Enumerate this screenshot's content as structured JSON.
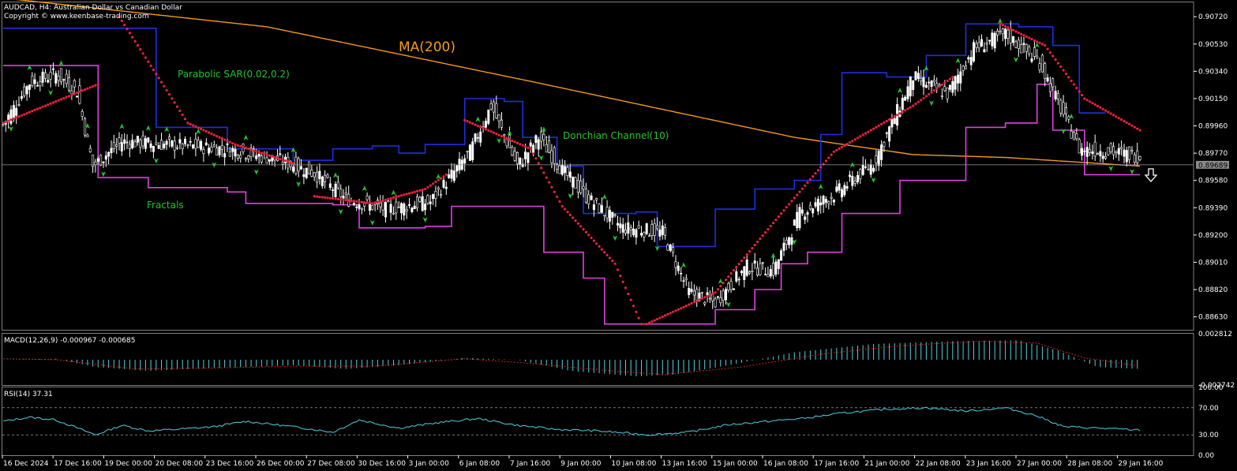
{
  "header": {
    "title": "AUDCAD, H4:  Australian Dollar vs Canadian Dollar",
    "copyright": "Copyright © www.keenbase-trading.com"
  },
  "colors": {
    "background": "#000000",
    "candle": "#ffffff",
    "ma200": "#f59a1c",
    "donchian_upper": "#1f2fdc",
    "donchian_lower": "#e040e0",
    "sar": "#e8223a",
    "fractal": "#22c52a",
    "annotation": "#22c52a",
    "macd_hist": "#4fd0e0",
    "macd_signal": "#d02020",
    "rsi": "#4fd0e0",
    "axis_text": "#ffffff",
    "frame": "#808080"
  },
  "chart_data": {
    "type": "line",
    "title": "AUDCAD, H4:  Australian Dollar vs Canadian Dollar",
    "price_panel": {
      "ylim": [
        0.8854,
        0.9082
      ],
      "y_ticks": [
        "0.90720",
        "0.90530",
        "0.90340",
        "0.90150",
        "0.89960",
        "0.89770",
        "0.89580",
        "0.89390",
        "0.89200",
        "0.89010",
        "0.88820",
        "0.88630"
      ],
      "current_price": "0.89689",
      "annotations": {
        "ma": "MA(200)",
        "sar": "Parabolic SAR(0.02,0.2)",
        "donchian": "Donchian Channel(10)",
        "fractals": "Fractals"
      },
      "close_keypoints": [
        [
          0,
          0.8997
        ],
        [
          10,
          0.9026
        ],
        [
          20,
          0.9032
        ],
        [
          28,
          0.902
        ],
        [
          34,
          0.8968
        ],
        [
          45,
          0.8985
        ],
        [
          70,
          0.8982
        ],
        [
          85,
          0.898
        ],
        [
          105,
          0.8972
        ],
        [
          118,
          0.8963
        ],
        [
          130,
          0.8945
        ],
        [
          145,
          0.8938
        ],
        [
          162,
          0.8943
        ],
        [
          177,
          0.8978
        ],
        [
          185,
          0.901
        ],
        [
          195,
          0.8968
        ],
        [
          203,
          0.8988
        ],
        [
          212,
          0.8965
        ],
        [
          222,
          0.8945
        ],
        [
          235,
          0.8925
        ],
        [
          250,
          0.8922
        ],
        [
          260,
          0.888
        ],
        [
          270,
          0.8873
        ],
        [
          282,
          0.8898
        ],
        [
          292,
          0.8895
        ],
        [
          302,
          0.8935
        ],
        [
          315,
          0.8948
        ],
        [
          330,
          0.897
        ],
        [
          345,
          0.903
        ],
        [
          358,
          0.9018
        ],
        [
          368,
          0.905
        ],
        [
          380,
          0.906
        ],
        [
          393,
          0.904
        ],
        [
          408,
          0.898
        ],
        [
          420,
          0.8978
        ],
        [
          431,
          0.8975
        ]
      ],
      "ma200": [
        [
          0,
          0.9085
        ],
        [
          100,
          0.9065
        ],
        [
          200,
          0.9027
        ],
        [
          300,
          0.8988
        ],
        [
          345,
          0.8976
        ],
        [
          380,
          0.8974
        ],
        [
          431,
          0.8968
        ]
      ],
      "donchian_upper": [
        [
          0,
          0.9064
        ],
        [
          45,
          0.9064
        ],
        [
          58,
          0.8995
        ],
        [
          85,
          0.898
        ],
        [
          110,
          0.8972
        ],
        [
          125,
          0.898
        ],
        [
          140,
          0.8982
        ],
        [
          150,
          0.8977
        ],
        [
          160,
          0.8983
        ],
        [
          175,
          0.9015
        ],
        [
          190,
          0.9013
        ],
        [
          197,
          0.8988
        ],
        [
          210,
          0.8968
        ],
        [
          220,
          0.8935
        ],
        [
          240,
          0.8936
        ],
        [
          248,
          0.8912
        ],
        [
          265,
          0.8912
        ],
        [
          270,
          0.8938
        ],
        [
          285,
          0.8952
        ],
        [
          300,
          0.8958
        ],
        [
          310,
          0.899
        ],
        [
          318,
          0.9033
        ],
        [
          335,
          0.903
        ],
        [
          350,
          0.9045
        ],
        [
          365,
          0.9067
        ],
        [
          385,
          0.9065
        ],
        [
          398,
          0.9052
        ],
        [
          408,
          0.9005
        ],
        [
          418,
          0.9005
        ]
      ],
      "donchian_lower": [
        [
          0,
          0.9038
        ],
        [
          30,
          0.9038
        ],
        [
          36,
          0.896
        ],
        [
          55,
          0.8953
        ],
        [
          85,
          0.895
        ],
        [
          92,
          0.8942
        ],
        [
          125,
          0.8941
        ],
        [
          135,
          0.8925
        ],
        [
          160,
          0.8926
        ],
        [
          170,
          0.894
        ],
        [
          195,
          0.894
        ],
        [
          205,
          0.8908
        ],
        [
          220,
          0.889
        ],
        [
          228,
          0.8858
        ],
        [
          262,
          0.8858
        ],
        [
          270,
          0.8868
        ],
        [
          285,
          0.8882
        ],
        [
          295,
          0.89
        ],
        [
          305,
          0.8908
        ],
        [
          318,
          0.8935
        ],
        [
          340,
          0.8958
        ],
        [
          358,
          0.8958
        ],
        [
          365,
          0.8995
        ],
        [
          380,
          0.8998
        ],
        [
          392,
          0.9025
        ],
        [
          398,
          0.8993
        ],
        [
          410,
          0.8962
        ],
        [
          431,
          0.8962
        ]
      ],
      "sar_segments": [
        {
          "points": [
            [
              0,
              0.8998
            ],
            [
              36,
              0.9025
            ]
          ]
        },
        {
          "points": [
            [
              44,
              0.9072
            ],
            [
              70,
              0.8998
            ],
            [
              88,
              0.8983
            ],
            [
              110,
              0.897
            ]
          ]
        },
        {
          "points": [
            [
              118,
              0.8947
            ],
            [
              140,
              0.8942
            ],
            [
              160,
              0.8952
            ],
            [
              168,
              0.8962
            ]
          ]
        },
        {
          "points": [
            [
              175,
              0.9
            ],
            [
              200,
              0.898
            ],
            [
              212,
              0.894
            ],
            [
              232,
              0.89
            ],
            [
              242,
              0.8858
            ]
          ]
        },
        {
          "points": [
            [
              244,
              0.8858
            ],
            [
              270,
              0.888
            ],
            [
              295,
              0.8935
            ],
            [
              315,
              0.8978
            ],
            [
              345,
              0.901
            ],
            [
              360,
              0.903
            ]
          ]
        },
        {
          "points": [
            [
              378,
              0.9067
            ],
            [
              395,
              0.9052
            ],
            [
              410,
              0.9015
            ],
            [
              431,
              0.8993
            ]
          ]
        }
      ],
      "fractals_up_index": [
        10,
        22,
        32,
        45,
        55,
        62,
        74,
        92,
        110,
        126,
        137,
        148,
        165,
        180,
        192,
        205,
        228,
        258,
        272,
        292,
        310,
        322,
        340,
        350,
        362,
        378,
        392,
        405
      ],
      "fractals_down_index": [
        3,
        18,
        38,
        58,
        80,
        96,
        112,
        128,
        140,
        160,
        188,
        204,
        215,
        232,
        248,
        275,
        300,
        330,
        352,
        384,
        402,
        420,
        428
      ]
    },
    "macd_panel": {
      "label": "MACD(12,26,9) -0.000967 -0.000685",
      "ylim": [
        -0.002742,
        0.002812
      ],
      "y_ticks": [
        "0.002812",
        "-0.002742"
      ],
      "histogram_keypoints": [
        [
          0,
          0.0
        ],
        [
          20,
          0.0001
        ],
        [
          35,
          -0.0008
        ],
        [
          55,
          -0.0012
        ],
        [
          80,
          -0.0009
        ],
        [
          110,
          -0.0006
        ],
        [
          130,
          -0.001
        ],
        [
          150,
          -0.0006
        ],
        [
          175,
          0.0002
        ],
        [
          195,
          0.0
        ],
        [
          215,
          -0.0012
        ],
        [
          240,
          -0.0018
        ],
        [
          255,
          -0.0016
        ],
        [
          275,
          -0.0006
        ],
        [
          300,
          0.0008
        ],
        [
          330,
          0.0017
        ],
        [
          360,
          0.002
        ],
        [
          385,
          0.0021
        ],
        [
          400,
          0.001
        ],
        [
          415,
          -0.0008
        ],
        [
          431,
          -0.001
        ]
      ],
      "signal_keypoints": [
        [
          0,
          0.0001
        ],
        [
          20,
          0.0
        ],
        [
          50,
          -0.001
        ],
        [
          80,
          -0.0009
        ],
        [
          110,
          -0.0007
        ],
        [
          140,
          -0.0007
        ],
        [
          175,
          0.0001
        ],
        [
          200,
          -0.0004
        ],
        [
          230,
          -0.0012
        ],
        [
          250,
          -0.0016
        ],
        [
          280,
          -0.0008
        ],
        [
          310,
          0.0006
        ],
        [
          340,
          0.0015
        ],
        [
          370,
          0.002
        ],
        [
          392,
          0.0018
        ],
        [
          410,
          0.0002
        ],
        [
          431,
          -0.0007
        ]
      ]
    },
    "rsi_panel": {
      "label": "RSI(14) 37.31",
      "ylim": [
        0,
        100
      ],
      "y_ticks": [
        "100.00",
        "70.00",
        "30.00",
        "0.00"
      ],
      "levels": [
        70,
        30
      ],
      "keypoints": [
        [
          0,
          50
        ],
        [
          10,
          56
        ],
        [
          20,
          52
        ],
        [
          35,
          30
        ],
        [
          45,
          44
        ],
        [
          55,
          36
        ],
        [
          65,
          38
        ],
        [
          80,
          42
        ],
        [
          92,
          50
        ],
        [
          110,
          42
        ],
        [
          125,
          34
        ],
        [
          135,
          52
        ],
        [
          150,
          40
        ],
        [
          165,
          48
        ],
        [
          180,
          54
        ],
        [
          195,
          44
        ],
        [
          210,
          38
        ],
        [
          225,
          36
        ],
        [
          245,
          30
        ],
        [
          260,
          34
        ],
        [
          275,
          45
        ],
        [
          290,
          50
        ],
        [
          305,
          55
        ],
        [
          318,
          62
        ],
        [
          335,
          68
        ],
        [
          350,
          70
        ],
        [
          365,
          65
        ],
        [
          380,
          70
        ],
        [
          392,
          58
        ],
        [
          402,
          42
        ],
        [
          415,
          40
        ],
        [
          431,
          37
        ]
      ]
    },
    "x_ticks": [
      "16 Dec 2024",
      "17 Dec 16:00",
      "19 Dec 00:00",
      "20 Dec 08:00",
      "23 Dec 16:00",
      "26 Dec 00:00",
      "27 Dec 08:00",
      "30 Dec 16:00",
      "3 Jan 00:00",
      "6 Jan 08:00",
      "7 Jan 16:00",
      "9 Jan 00:00",
      "10 Jan 08:00",
      "13 Jan 16:00",
      "15 Jan 00:00",
      "16 Jan 08:00",
      "17 Jan 16:00",
      "21 Jan 00:00",
      "22 Jan 08:00",
      "23 Jan 16:00",
      "27 Jan 00:00",
      "28 Jan 08:00",
      "29 Jan 16:00"
    ],
    "signal_arrow": "down"
  }
}
